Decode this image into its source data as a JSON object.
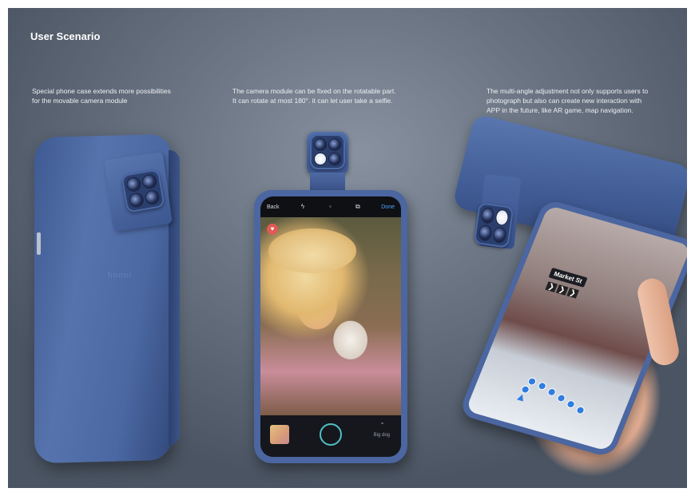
{
  "title": "User Scenario",
  "captions": {
    "left": [
      "Special phone case extends more possibilities",
      "for the movable camera module"
    ],
    "middle": [
      "The camera module can be fixed on the rotatable part.",
      "It can rotate at most 180°. it can let user take a selfie."
    ],
    "right": [
      "The multi-angle adjustment not only supports users to",
      "photograph but also can create new interaction with",
      "APP in the future, like AR game, map navigation."
    ]
  },
  "camera_app": {
    "back_label": "Back",
    "flash_icon": "flash-auto-icon",
    "switch_icon": "camera-switch-icon",
    "done_label": "Done",
    "mode_label": "Big dog"
  },
  "ar_app": {
    "street_sign": "Market St"
  },
  "colors": {
    "case_blue": "#4b66a0",
    "shutter_ring": "#4ec0c5",
    "nav_blue": "#2f7de0"
  }
}
